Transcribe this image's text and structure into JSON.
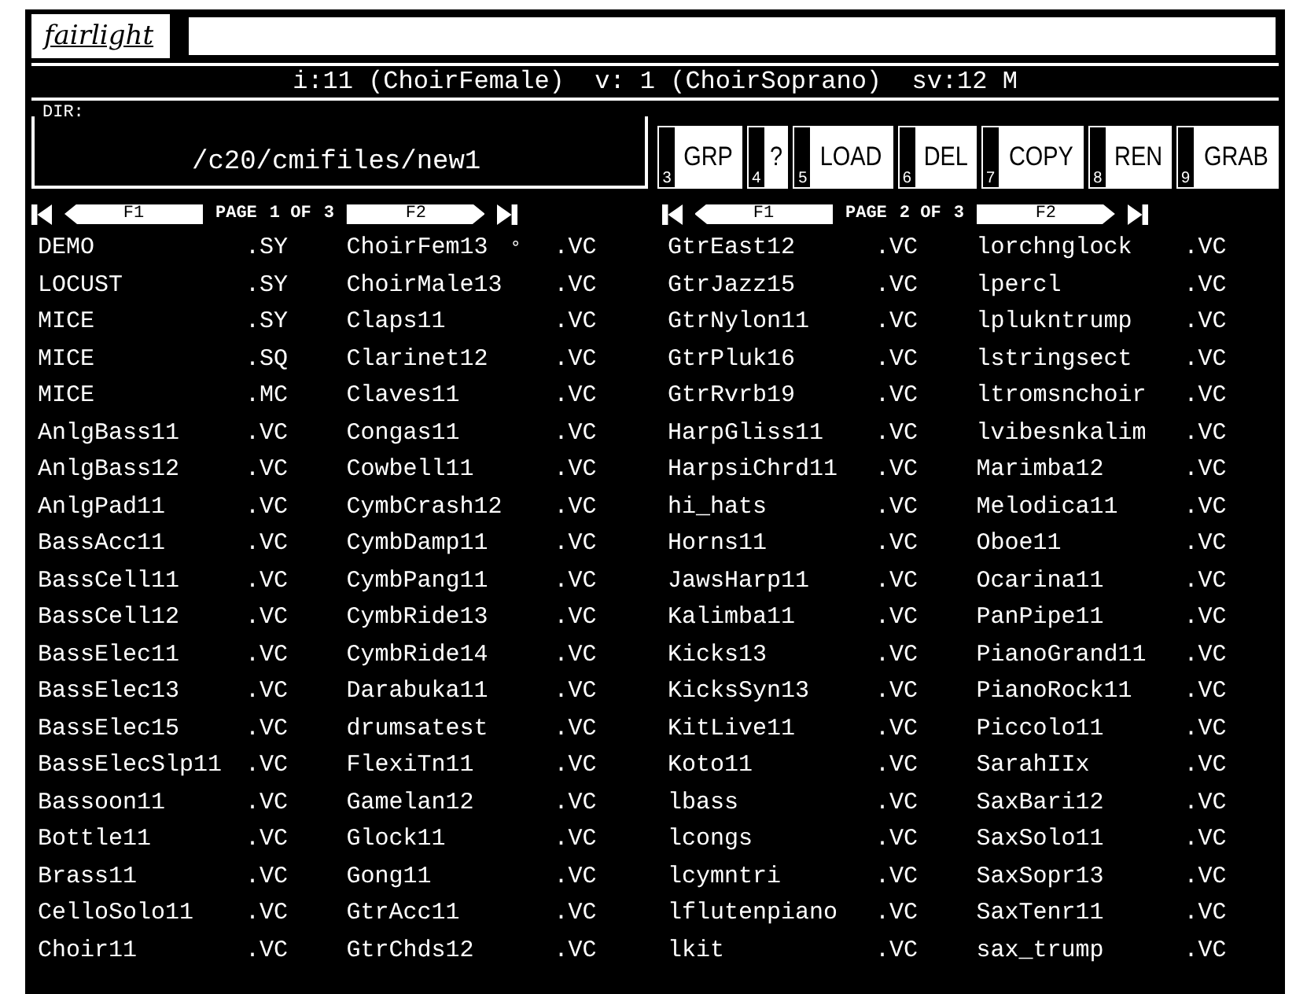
{
  "logo": "fairlight",
  "status": "i:11 (ChoirFemale)  v: 1 (ChoirSoprano)  sv:12 M",
  "dir": {
    "label": "DIR:",
    "path": "/c20/cmifiles/new1"
  },
  "buttons": [
    {
      "key": "3",
      "label": "GRP"
    },
    {
      "key": "4",
      "label": "?"
    },
    {
      "key": "5",
      "label": "LOAD"
    },
    {
      "key": "6",
      "label": "DEL"
    },
    {
      "key": "7",
      "label": "COPY"
    },
    {
      "key": "8",
      "label": "REN"
    },
    {
      "key": "9",
      "label": "GRAB"
    }
  ],
  "panels": [
    {
      "f1": "F1",
      "f2": "F2",
      "page_label": "PAGE",
      "page": "1 OF",
      "total": "3",
      "columns": [
        [
          {
            "name": "DEMO",
            "ext": ".SY"
          },
          {
            "name": "LOCUST",
            "ext": ".SY"
          },
          {
            "name": "MICE",
            "ext": ".SY"
          },
          {
            "name": "MICE",
            "ext": ".SQ"
          },
          {
            "name": "MICE",
            "ext": ".MC"
          },
          {
            "name": "AnlgBass11",
            "ext": ".VC"
          },
          {
            "name": "AnlgBass12",
            "ext": ".VC"
          },
          {
            "name": "AnlgPad11",
            "ext": ".VC"
          },
          {
            "name": "BassAcc11",
            "ext": ".VC"
          },
          {
            "name": "BassCell11",
            "ext": ".VC"
          },
          {
            "name": "BassCell12",
            "ext": ".VC"
          },
          {
            "name": "BassElec11",
            "ext": ".VC"
          },
          {
            "name": "BassElec13",
            "ext": ".VC"
          },
          {
            "name": "BassElec15",
            "ext": ".VC"
          },
          {
            "name": "BassElecSlp11",
            "ext": ".VC"
          },
          {
            "name": "Bassoon11",
            "ext": ".VC"
          },
          {
            "name": "Bottle11",
            "ext": ".VC"
          },
          {
            "name": "Brass11",
            "ext": ".VC"
          },
          {
            "name": "CelloSolo11",
            "ext": ".VC"
          },
          {
            "name": "Choir11",
            "ext": ".VC"
          }
        ],
        [
          {
            "name": "ChoirFem13",
            "mark": "°",
            "ext": ".VC"
          },
          {
            "name": "ChoirMale13",
            "ext": ".VC"
          },
          {
            "name": "Claps11",
            "ext": ".VC"
          },
          {
            "name": "Clarinet12",
            "ext": ".VC"
          },
          {
            "name": "Claves11",
            "ext": ".VC"
          },
          {
            "name": "Congas11",
            "ext": ".VC"
          },
          {
            "name": "Cowbell11",
            "ext": ".VC"
          },
          {
            "name": "CymbCrash12",
            "ext": ".VC"
          },
          {
            "name": "CymbDamp11",
            "ext": ".VC"
          },
          {
            "name": "CymbPang11",
            "ext": ".VC"
          },
          {
            "name": "CymbRide13",
            "ext": ".VC"
          },
          {
            "name": "CymbRide14",
            "ext": ".VC"
          },
          {
            "name": "Darabuka11",
            "ext": ".VC"
          },
          {
            "name": "drumsatest",
            "ext": ".VC"
          },
          {
            "name": "FlexiTn11",
            "ext": ".VC"
          },
          {
            "name": "Gamelan12",
            "ext": ".VC"
          },
          {
            "name": "Glock11",
            "ext": ".VC"
          },
          {
            "name": "Gong11",
            "ext": ".VC"
          },
          {
            "name": "GtrAcc11",
            "ext": ".VC"
          },
          {
            "name": "GtrChds12",
            "ext": ".VC"
          }
        ]
      ]
    },
    {
      "f1": "F1",
      "f2": "F2",
      "page_label": "PAGE",
      "page": "2 OF",
      "total": "3",
      "columns": [
        [
          {
            "name": "GtrEast12",
            "ext": ".VC"
          },
          {
            "name": "GtrJazz15",
            "ext": ".VC"
          },
          {
            "name": "GtrNylon11",
            "ext": ".VC"
          },
          {
            "name": "GtrPluk16",
            "ext": ".VC"
          },
          {
            "name": "GtrRvrb19",
            "ext": ".VC"
          },
          {
            "name": "HarpGliss11",
            "ext": ".VC"
          },
          {
            "name": "HarpsiChrd11",
            "ext": ".VC"
          },
          {
            "name": "hi_hats",
            "ext": ".VC"
          },
          {
            "name": "Horns11",
            "ext": ".VC"
          },
          {
            "name": "JawsHarp11",
            "ext": ".VC"
          },
          {
            "name": "Kalimba11",
            "ext": ".VC"
          },
          {
            "name": "Kicks13",
            "ext": ".VC"
          },
          {
            "name": "KicksSyn13",
            "ext": ".VC"
          },
          {
            "name": "KitLive11",
            "ext": ".VC"
          },
          {
            "name": "Koto11",
            "ext": ".VC"
          },
          {
            "name": "lbass",
            "ext": ".VC"
          },
          {
            "name": "lcongs",
            "ext": ".VC"
          },
          {
            "name": "lcymntri",
            "ext": ".VC"
          },
          {
            "name": "lflutenpiano",
            "ext": ".VC"
          },
          {
            "name": "lkit",
            "ext": ".VC"
          }
        ],
        [
          {
            "name": "lorchnglock",
            "ext": ".VC"
          },
          {
            "name": "lpercl",
            "ext": ".VC"
          },
          {
            "name": "lplukntrump",
            "ext": ".VC"
          },
          {
            "name": "lstringsect",
            "ext": ".VC"
          },
          {
            "name": "ltromsnchoir",
            "ext": ".VC"
          },
          {
            "name": "lvibesnkalim",
            "ext": ".VC"
          },
          {
            "name": "Marimba12",
            "ext": ".VC"
          },
          {
            "name": "Melodica11",
            "ext": ".VC"
          },
          {
            "name": "Oboe11",
            "ext": ".VC"
          },
          {
            "name": "Ocarina11",
            "ext": ".VC"
          },
          {
            "name": "PanPipe11",
            "ext": ".VC"
          },
          {
            "name": "PianoGrand11",
            "ext": ".VC"
          },
          {
            "name": "PianoRock11",
            "ext": ".VC"
          },
          {
            "name": "Piccolo11",
            "ext": ".VC"
          },
          {
            "name": "SarahIIx",
            "ext": ".VC"
          },
          {
            "name": "SaxBari12",
            "ext": ".VC"
          },
          {
            "name": "SaxSolo11",
            "ext": ".VC"
          },
          {
            "name": "SaxSopr13",
            "ext": ".VC"
          },
          {
            "name": "SaxTenr11",
            "ext": ".VC"
          },
          {
            "name": "sax_trump",
            "ext": ".VC"
          }
        ]
      ]
    }
  ]
}
